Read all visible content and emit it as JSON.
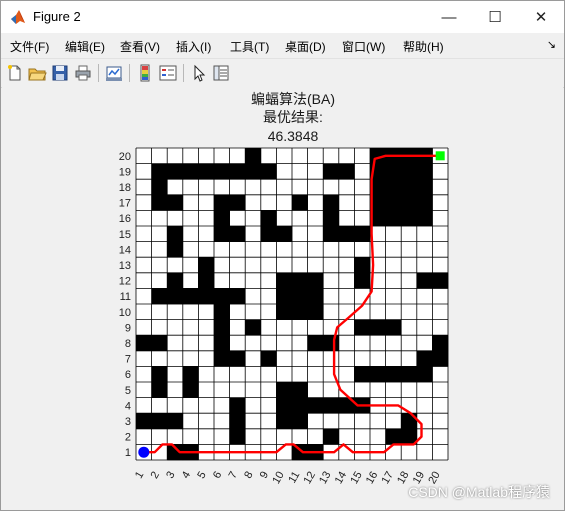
{
  "window": {
    "title": "Figure 2",
    "icon": "matlab-logo-icon",
    "controls": {
      "minimize": "—",
      "maximize": "☐",
      "close": "✕"
    }
  },
  "menu": {
    "items": [
      {
        "label": "文件(F)"
      },
      {
        "label": "编辑(E)"
      },
      {
        "label": "查看(V)"
      },
      {
        "label": "插入(I)"
      },
      {
        "label": "工具(T)"
      },
      {
        "label": "桌面(D)"
      },
      {
        "label": "窗口(W)"
      },
      {
        "label": "帮助(H)"
      }
    ],
    "overflow": "↘"
  },
  "toolbar": {
    "buttons": [
      "new-figure-icon",
      "open-file-icon",
      "save-icon",
      "print-icon",
      "link-plot-icon",
      "insert-colorbar-icon",
      "insert-legend-icon",
      "edit-plot-arrow-icon",
      "property-inspector-icon"
    ]
  },
  "chart_data": {
    "type": "heatmap",
    "title_lines": [
      "蝙蝠算法(BA)",
      "最优结果:",
      "46.3848"
    ],
    "x_ticks": [
      "1",
      "2",
      "3",
      "4",
      "5",
      "6",
      "7",
      "8",
      "9",
      "10",
      "11",
      "12",
      "13",
      "14",
      "15",
      "16",
      "17",
      "18",
      "19",
      "20"
    ],
    "y_ticks": [
      "1",
      "2",
      "3",
      "4",
      "5",
      "6",
      "7",
      "8",
      "9",
      "10",
      "11",
      "12",
      "13",
      "14",
      "15",
      "16",
      "17",
      "18",
      "19",
      "20"
    ],
    "grid": true,
    "colors": {
      "free": "#ffffff",
      "obstacle": "#000000",
      "path": "#ff0000",
      "start": "#0000ff",
      "goal": "#00ff00"
    },
    "grid_rows_top_to_bottom": [
      "00000001000000000000",
      "01111111111001100000",
      "01000000000000000000",
      "01100110001010000000",
      "00000100000000000000",
      "00000011000000000000",
      "00000000000000000000",
      "00001000000000000000",
      "00001000000000000000",
      "00000000000000000000",
      "00000010000000000000",
      "00000110000000000000",
      "00000000000000000000",
      "01100000000000000000",
      "00000000010000000000",
      "00000000010000000000",
      "00000000000000000000",
      "01100000000000000000",
      "00000000000000000000",
      "00000000000000000000"
    ],
    "obstacle_runs": [
      [
        1,
        20,
        7,
        7
      ],
      [
        2,
        19,
        1,
        8
      ],
      [
        2,
        19,
        12,
        13
      ],
      [
        2,
        18,
        1,
        1
      ],
      [
        2,
        17,
        1,
        2
      ],
      [
        2,
        17,
        5,
        6
      ],
      [
        2,
        17,
        10,
        10
      ],
      [
        2,
        17,
        12,
        12
      ],
      [
        2,
        16,
        5,
        5
      ],
      [
        2,
        16,
        8,
        8
      ],
      [
        2,
        16,
        12,
        12
      ],
      [
        2,
        15,
        2,
        2
      ],
      [
        2,
        15,
        5,
        6
      ],
      [
        2,
        15,
        8,
        9
      ],
      [
        2,
        15,
        12,
        14
      ],
      [
        2,
        14,
        2,
        2
      ],
      [
        2,
        13,
        4,
        4
      ],
      [
        2,
        13,
        14,
        14
      ],
      [
        2,
        12,
        2,
        2
      ],
      [
        2,
        12,
        4,
        4
      ],
      [
        2,
        12,
        9,
        11
      ],
      [
        2,
        12,
        14,
        14
      ],
      [
        2,
        12,
        18,
        19
      ],
      [
        2,
        11,
        1,
        6
      ],
      [
        2,
        11,
        9,
        11
      ],
      [
        2,
        10,
        5,
        5
      ],
      [
        2,
        10,
        9,
        11
      ],
      [
        2,
        9,
        5,
        5
      ],
      [
        2,
        9,
        7,
        7
      ],
      [
        2,
        9,
        14,
        16
      ],
      [
        2,
        8,
        0,
        1
      ],
      [
        2,
        8,
        5,
        5
      ],
      [
        2,
        8,
        11,
        12
      ],
      [
        2,
        8,
        19,
        19
      ],
      [
        2,
        7,
        5,
        6
      ],
      [
        2,
        7,
        8,
        8
      ],
      [
        2,
        7,
        18,
        19
      ],
      [
        2,
        6,
        1,
        1
      ],
      [
        2,
        6,
        3,
        3
      ],
      [
        2,
        6,
        14,
        18
      ],
      [
        2,
        5,
        1,
        1
      ],
      [
        2,
        5,
        3,
        3
      ],
      [
        2,
        5,
        9,
        10
      ],
      [
        2,
        4,
        6,
        6
      ],
      [
        2,
        4,
        9,
        14
      ],
      [
        2,
        3,
        0,
        2
      ],
      [
        2,
        3,
        6,
        6
      ],
      [
        2,
        3,
        9,
        10
      ],
      [
        2,
        3,
        17,
        17
      ],
      [
        2,
        2,
        6,
        6
      ],
      [
        2,
        2,
        12,
        12
      ],
      [
        2,
        2,
        16,
        17
      ],
      [
        2,
        1,
        2,
        3
      ],
      [
        2,
        1,
        10,
        11
      ]
    ],
    "obstacle_blocks": [
      [
        16,
        16,
        19,
        20
      ]
    ],
    "path": [
      [
        1,
        1
      ],
      [
        1.7,
        1
      ],
      [
        2.2,
        1.5
      ],
      [
        2.8,
        1.5
      ],
      [
        3.3,
        1
      ],
      [
        4.2,
        1
      ],
      [
        9.5,
        1
      ],
      [
        10.1,
        1.5
      ],
      [
        10.6,
        1.5
      ],
      [
        11.2,
        1
      ],
      [
        12.6,
        1
      ],
      [
        13.2,
        1
      ],
      [
        13.8,
        1.5
      ],
      [
        14.4,
        1
      ],
      [
        16.4,
        1
      ],
      [
        17,
        1.5
      ],
      [
        18.3,
        1.5
      ],
      [
        18.8,
        2
      ],
      [
        18.8,
        2.8
      ],
      [
        18.1,
        3.5
      ],
      [
        17.3,
        4
      ],
      [
        15.6,
        4
      ],
      [
        14.7,
        4
      ],
      [
        13.6,
        5
      ],
      [
        13.2,
        6
      ],
      [
        13.2,
        8.2
      ],
      [
        13.4,
        9
      ],
      [
        14.1,
        9.6
      ],
      [
        15,
        10.4
      ],
      [
        15.6,
        11.3
      ],
      [
        15.7,
        13
      ],
      [
        15.6,
        15
      ],
      [
        15.6,
        18.5
      ],
      [
        15.8,
        19.8
      ],
      [
        16.5,
        20
      ],
      [
        19.9,
        20
      ]
    ],
    "start": [
      1,
      1
    ],
    "goal": [
      20,
      20
    ]
  },
  "watermark": "CSDN @Matlab程序猿"
}
